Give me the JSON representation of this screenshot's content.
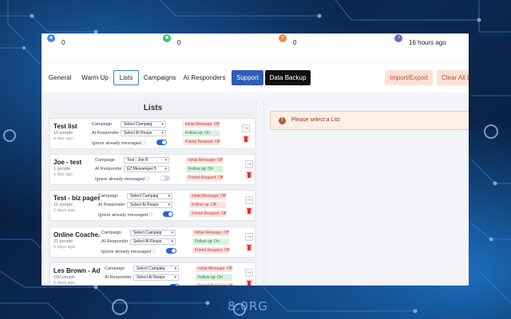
{
  "colors": {
    "accent": "#2e5db5",
    "primary": "#3b82d6",
    "danger": "#c0392b",
    "success": "#2d7a3e"
  },
  "background": {
    "overlay_text": "8.0RG"
  },
  "stats": [
    {
      "icon": "users-icon",
      "value": "0",
      "color": "#4a8be0"
    },
    {
      "icon": "chat-icon",
      "value": "0",
      "color": "#3fbf6a"
    },
    {
      "icon": "user-add-icon",
      "value": "0",
      "color": "#f08a4b"
    },
    {
      "icon": "clock-icon",
      "value": "16 hours ago",
      "color": "#6a6fd1"
    }
  ],
  "tabs": [
    {
      "label": "General"
    },
    {
      "label": "Warm Up"
    },
    {
      "label": "Lists",
      "active": true
    },
    {
      "label": "Campaigns"
    },
    {
      "label": "AI Responders"
    },
    {
      "label": "Support"
    },
    {
      "label": "Data Backup"
    },
    {
      "label": "Import/Export"
    },
    {
      "label": "Clear All D"
    }
  ],
  "lists_panel": {
    "title": "Lists"
  },
  "labels": {
    "campaign": "Campaign",
    "ai_responder": "AI Responder",
    "ignore": "Ignore already messaged"
  },
  "lists": [
    {
      "name": "Test list",
      "people": "16 people",
      "ago": "a day ago",
      "campaign": "Select Campaig",
      "responder": "Select AI Respo",
      "ignore_on": true,
      "initial": "Initial Message: Off",
      "follow": "Follow up: On",
      "friend": "Friend Request: Off"
    },
    {
      "name": "Joe - test",
      "people": "1 people",
      "ago": "a day ago",
      "campaign": "Test - Joe B",
      "responder": "EZ Messenger 5",
      "ignore_on": false,
      "initial": "Initial Message: Off",
      "follow": "Follow up: On",
      "friend": "Friend Request: Off"
    },
    {
      "name": "Test - biz pages",
      "people": "16 people",
      "ago": "2 days ago",
      "campaign": "Select Campaig",
      "responder": "Select AI Respo",
      "ignore_on": true,
      "initial": "Initial Message: Off",
      "follow": "Follow up: Off",
      "friend": "Friend Request: Off"
    },
    {
      "name": "Online Coache...",
      "people": "31 people",
      "ago": "5 days ago",
      "campaign": "Select Campaig",
      "responder": "Select AI Respo",
      "ignore_on": true,
      "initial": "Initial Message: Off",
      "follow": "Follow up: On",
      "friend": "Friend Request: Off"
    },
    {
      "name": "Les Brown - Ad...",
      "people": "160 people",
      "ago": "6 days ago",
      "campaign": "Select Campaig",
      "responder": "Select AI Respo",
      "ignore_on": true,
      "initial": "Initial Message: Off",
      "follow": "Follow up: On",
      "friend": "Friend Request: Off"
    }
  ],
  "alert": {
    "text": "Please select a List"
  }
}
